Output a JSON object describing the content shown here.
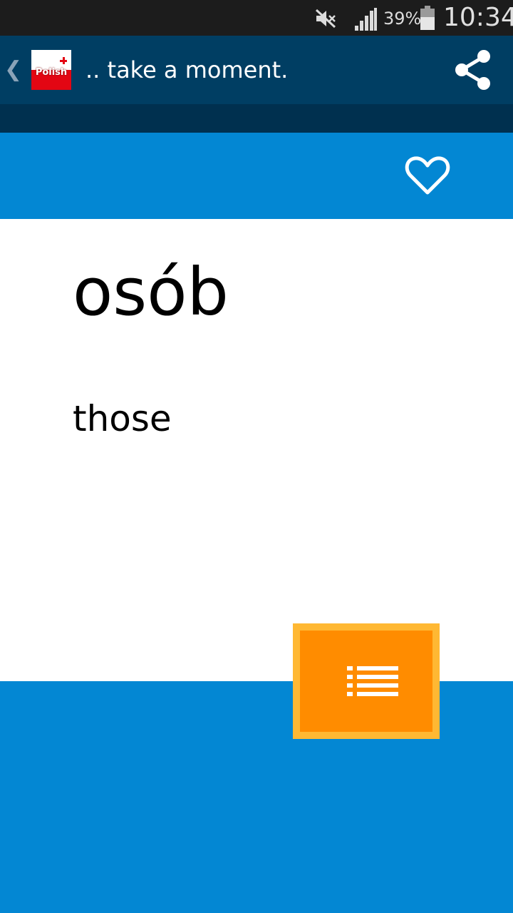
{
  "status_bar": {
    "battery_percent": "39%",
    "time": "10:34",
    "icons": [
      "mute-icon",
      "signal-icon",
      "battery-icon"
    ]
  },
  "action_bar": {
    "back_icon": "chevron-left-icon",
    "back_glyph": "❮",
    "logo_text": "Polish",
    "title": ".. take a moment.",
    "share_icon": "share-icon"
  },
  "header": {
    "favorite_icon": "heart-outline-icon"
  },
  "card": {
    "word": "osób",
    "translation": "those"
  },
  "list_button": {
    "icon": "list-icon"
  },
  "colors": {
    "status_bar": "#1c1c1c",
    "action_bar": "#003e63",
    "sub_bar": "#00304f",
    "accent_blue": "#0387d3",
    "button_orange": "#ff8c00",
    "button_border": "#ffb833",
    "logo_red": "#e30613"
  }
}
